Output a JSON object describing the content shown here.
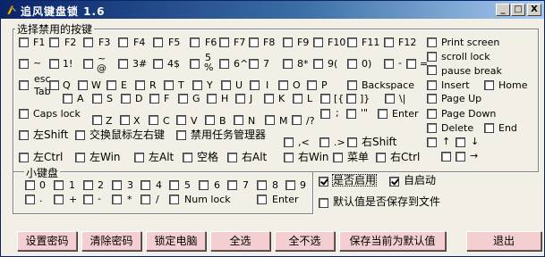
{
  "window": {
    "title": "追风键盘锁 1.6",
    "controls": {
      "minimize": "_",
      "maximize": "□",
      "close": "X"
    }
  },
  "groups": {
    "keys_title": "选择禁用的按键",
    "keypad_title": "小键盘"
  },
  "keys": {
    "f1": "F1",
    "f2": "F2",
    "f3": "F3",
    "f4": "F4",
    "f5": "F5",
    "f6": "F6",
    "f7": "F7",
    "f8": "F8",
    "f9": "F9",
    "f10": "F10",
    "f11": "F11",
    "f12": "F12",
    "print_screen": "Print screen",
    "scroll_lock": "scroll lock",
    "pause_break": "pause break",
    "tilde": "~",
    "n1": "1!",
    "n2_top": "~",
    "n2_bot": "@",
    "n3": "3#",
    "n4": "4$",
    "n5_top": "5",
    "n5_bot": "%",
    "n6": "6^",
    "n7": "7",
    "n8": "8*",
    "n9": "9(",
    "n0": "0)",
    "minus": "-",
    "equal": "=",
    "esc": "esc",
    "tab": "Tab",
    "q": "Q",
    "w": "W",
    "e": "E",
    "r": "R",
    "t": "T",
    "y": "Y",
    "u": "U",
    "i": "I",
    "o": "O",
    "p": "P",
    "backspace": "Backspace",
    "a": "A",
    "s": "S",
    "d": "D",
    "f": "F",
    "g": "G",
    "h": "H",
    "j": "J",
    "k": "K",
    "l": "L",
    "lbracket": "[{",
    "rbracket": "]}",
    "backslash": "\\|",
    "caps_lock": "Caps lock",
    "semicolon": ";",
    "quote": "'\"",
    "enter": "Enter",
    "z": "Z",
    "x": "X",
    "c": "C",
    "v": "V",
    "b": "B",
    "n": "N",
    "m": "M",
    "slash": "/?",
    "comma": ",<",
    "period": ".>",
    "left_shift": "左Shift",
    "swap_mouse": "交换鼠标左右键",
    "task_manager": "禁用任务管理器",
    "right_shift": "右Shift",
    "insert": "Insert",
    "home": "Home",
    "page_up": "Page Up",
    "page_down": "Page Down",
    "delete": "Delete",
    "end": "End",
    "up_arrow": "↑",
    "down_arrow": "↓",
    "left_arrow": "←",
    "right_arrow": "→",
    "left_ctrl": "左Ctrl",
    "left_win": "左Win",
    "left_alt": "左Alt",
    "space": "空格",
    "right_alt": "右Alt",
    "right_win": "右Win",
    "menu": "菜单",
    "right_ctrl": "右Ctrl"
  },
  "keypad": {
    "k0": "0",
    "k1": "1",
    "k2": "2",
    "k3": "3",
    "k4": "4",
    "k5": "5",
    "k6": "6",
    "k7": "7",
    "k8": "8",
    "k9": "9",
    "dot": ".",
    "plus": "+",
    "minus": "-",
    "star": "*",
    "slash": "/",
    "num_lock": "Num lock",
    "enter": "Enter"
  },
  "options": {
    "enabled": "是否启用",
    "autostart": "自启动",
    "default_saved": "默认值是否保存到文件",
    "enabled_checked": true,
    "autostart_checked": true,
    "default_saved_checked": false
  },
  "buttons": {
    "set_password": "设置密码",
    "clear_password": "清除密码",
    "lock_computer": "锁定电脑",
    "select_all": "全选",
    "select_none": "全不选",
    "save_default": "保存当前为默认值",
    "exit": "退出"
  }
}
